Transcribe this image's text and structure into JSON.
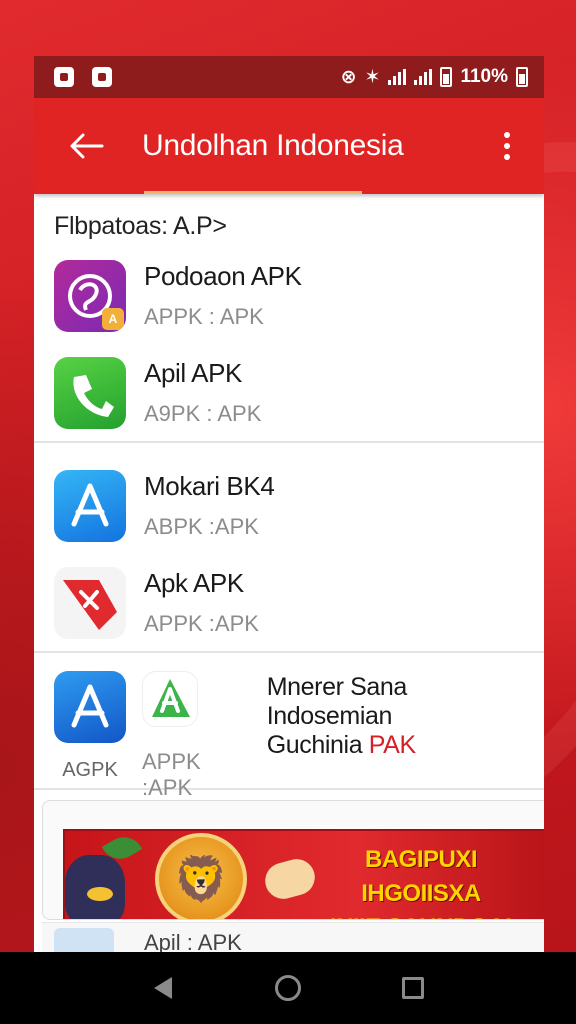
{
  "status_bar": {
    "battery_text": "110%"
  },
  "app_bar": {
    "title": "Undolhan Indonesia"
  },
  "section": {
    "header": "Flbpatoas: A.P>"
  },
  "groups": [
    {
      "items": [
        {
          "title": "Podoaon APK",
          "subtitle": "APPK : APK",
          "icon": "purple-swirl-app-icon"
        },
        {
          "title": "Apil APK",
          "subtitle": "A9PK : APK",
          "icon": "green-phone-app-icon"
        }
      ]
    },
    {
      "items": [
        {
          "title": "Mokari BK4",
          "subtitle": "ABPK :APK",
          "icon": "blue-a-store-icon"
        },
        {
          "title": "Apk APK",
          "subtitle": "APPK :APK",
          "icon": "red-tag-app-icon"
        }
      ]
    }
  ],
  "last_group": {
    "left_caption": "AGPK",
    "mid_subtitle": "APPK :APK",
    "right_line1": "Mnerer Sana Indosemian",
    "right_line2_prefix": "Guchinia ",
    "right_line2_accent": "PAK"
  },
  "promo": {
    "line1": "BAGIPUXI IHGOIISXA",
    "line2": "INIIE SAUNDGA!"
  },
  "peek_row": {
    "text": "Apil : APK"
  },
  "colors": {
    "background_red": "#d41f24",
    "app_bar_red": "#e02424",
    "status_bar_red": "#8f1c1c",
    "promo_yellow": "#ffd400"
  }
}
